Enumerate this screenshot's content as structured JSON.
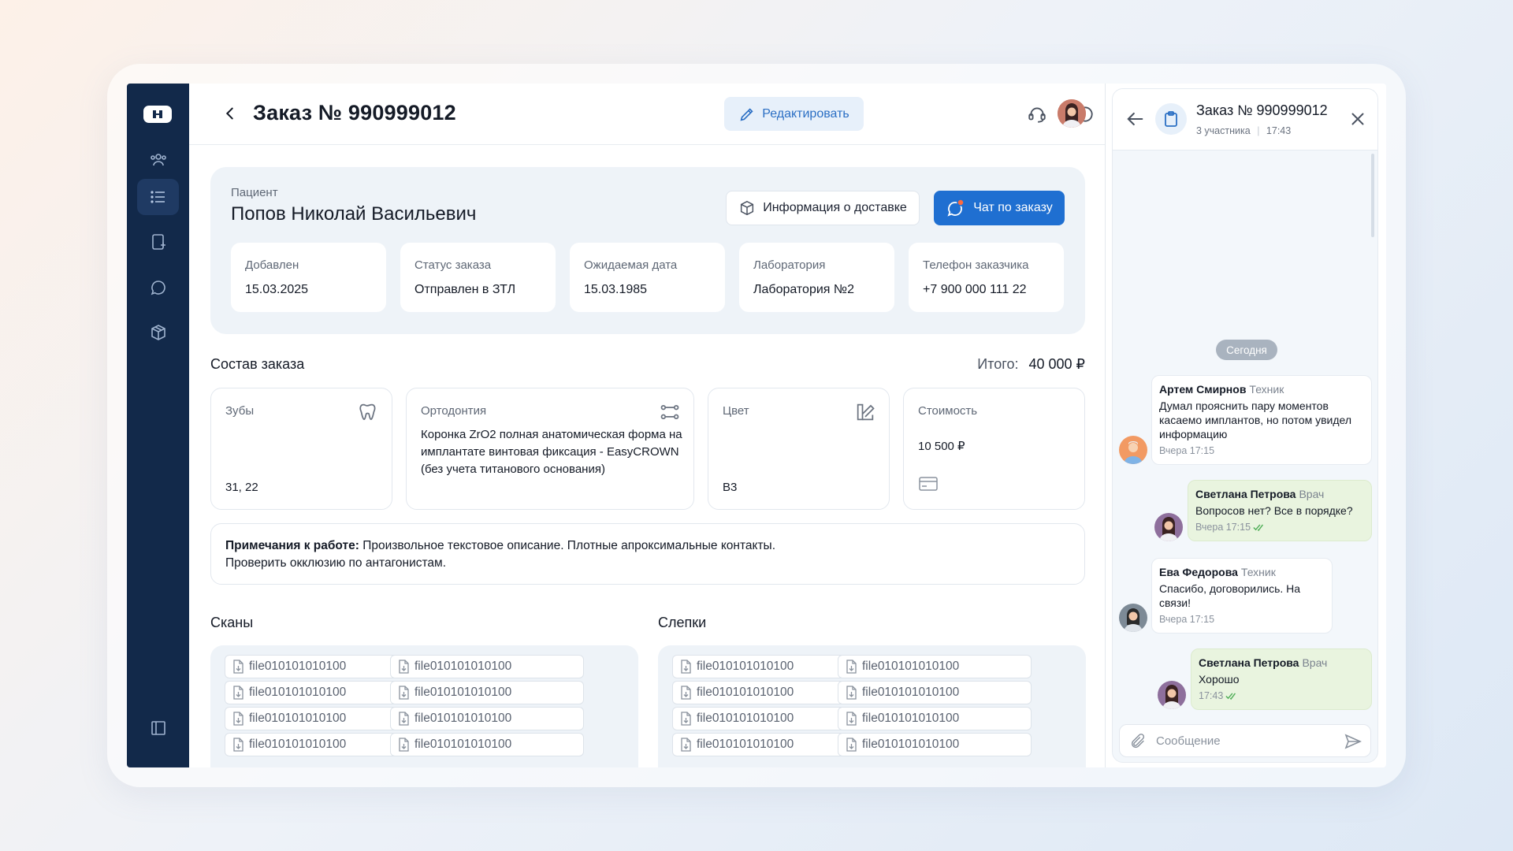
{
  "colors": {
    "sidebar": "#12294a",
    "accent": "#1f6fd1",
    "mine_bubble": "#e9f4df"
  },
  "header": {
    "title": "Заказ № 990999012",
    "edit_label": "Редактировать"
  },
  "patient": {
    "label": "Пациент",
    "name": "Попов Николай Васильевич",
    "delivery_label": "Информация о доставке",
    "chat_label": "Чат по заказу",
    "info": [
      {
        "label": "Добавлен",
        "value": "15.03.2025"
      },
      {
        "label": "Статус заказа",
        "value": "Отправлен в ЗТЛ"
      },
      {
        "label": "Ожидаемая дата",
        "value": "15.03.1985"
      },
      {
        "label": "Лаборатория",
        "value": "Лаборатория №2"
      },
      {
        "label": "Телефон заказчика",
        "value": "+7 900 000 111 22"
      }
    ]
  },
  "composition": {
    "title": "Состав заказа",
    "total_label": "Итого:",
    "total_value": "40 000 ₽",
    "teeth": {
      "label": "Зубы",
      "value": "31, 22"
    },
    "ortho": {
      "label": "Ортодонтия",
      "value": "Коронка ZrO2 полная анатомическая форма на имплантате винтовая фиксация - EasyCROWN (без учета титанового основания)"
    },
    "color": {
      "label": "Цвет",
      "value": "B3"
    },
    "cost": {
      "label": "Стоимость",
      "value": "10 500 ₽"
    }
  },
  "notes": {
    "label": "Примечания к работе:",
    "text1": " Произвольное текстовое описание. Плотные апроксимальные контакты.",
    "text2": "Проверить окклюзию по антагонистам."
  },
  "scans": {
    "title": "Сканы",
    "files": [
      "file010101010100",
      "file010101010100",
      "file010101010100",
      "file010101010100",
      "file010101010100",
      "file010101010100",
      "file010101010100",
      "file010101010100"
    ]
  },
  "casts": {
    "title": "Слепки",
    "files": [
      "file010101010100",
      "file010101010100",
      "file010101010100",
      "file010101010100",
      "file010101010100",
      "file010101010100",
      "file010101010100",
      "file010101010100"
    ]
  },
  "chat": {
    "title": "Заказ № 990999012",
    "participants": "3 участника",
    "time": "17:43",
    "day": "Сегодня",
    "messages": [
      {
        "author": "Артем Смирнов",
        "role": "Техник",
        "text": "Думал прояснить пару моментов касаемо имплантов, но потом увидел информацию",
        "time": "Вчера 17:15"
      },
      {
        "author": "Светлана Петрова",
        "role": "Врач",
        "text": "Вопросов нет? Все в порядке?",
        "time": "Вчера 17:15"
      },
      {
        "author": "Ева Федорова",
        "role": "Техник",
        "text": "Спасибо, договорились. На связи!",
        "time": "Вчера 17:15"
      },
      {
        "author": "Светлана Петрова",
        "role": "Врач",
        "text": "Хорошо",
        "time": "17:43"
      }
    ],
    "placeholder": "Сообщение"
  }
}
